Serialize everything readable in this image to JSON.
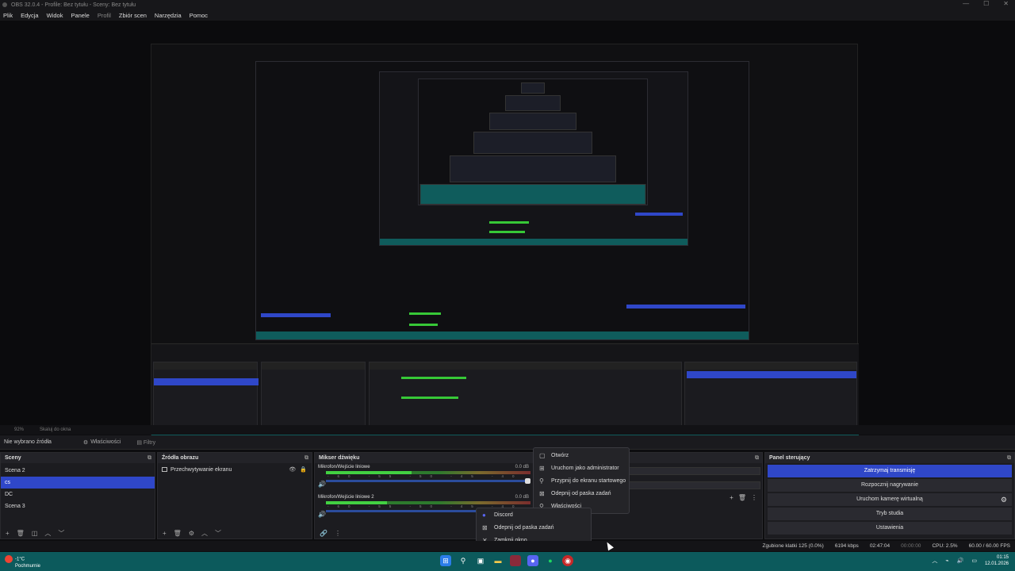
{
  "window": {
    "title": "OBS 32.0.4 - Profile: Bez tytułu - Sceny: Bez tytułu",
    "min": "—",
    "max": "☐",
    "close": "✕"
  },
  "menu": [
    "Plik",
    "Edycja",
    "Widok",
    "Panele",
    "Profil",
    "Zbiór scen",
    "Narzędzia",
    "Pomoc"
  ],
  "statusline": {
    "zoom": "92%",
    "mode": "Skaluj do okna"
  },
  "propbar": {
    "no_source": "Nie wybrano źródła",
    "properties": "Właściwości",
    "filters": "Filtry"
  },
  "scenes": {
    "title": "Sceny",
    "items": [
      "Scena 2",
      "cs",
      "DC",
      "Scena 3"
    ],
    "selected": 1
  },
  "sources": {
    "title": "Źródła obrazu",
    "items": [
      "Przechwytywanie ekranu"
    ]
  },
  "mixer": {
    "title": "Mikser dźwięku",
    "channels": [
      {
        "name": "Mikrofon/Wejście liniowe",
        "db": "0.0 dB",
        "level": 0.42
      },
      {
        "name": "Mikrofon/Wejście liniowe 2",
        "db": "0.0 dB",
        "level": 0.3
      }
    ],
    "ticks": "-60 -55 -50 -45 -40 -35 -30 -25 -20 -15 -10 -5 0"
  },
  "context_menu": {
    "items": [
      {
        "icon": "▢",
        "label": "Otwórz"
      },
      {
        "icon": "⊞",
        "label": "Uruchom jako administrator"
      },
      {
        "icon": "⚲",
        "label": "Przypnij do ekranu startowego"
      },
      {
        "icon": "⊠",
        "label": "Odepnij od paska zadań"
      },
      {
        "icon": "⚲",
        "label": "Właściwości"
      }
    ]
  },
  "jump_list": {
    "items": [
      {
        "icon": "●",
        "label": "Discord"
      },
      {
        "icon": "⊠",
        "label": "Odepnij od paska zadań"
      },
      {
        "icon": "✕",
        "label": "Zamknij okno"
      }
    ]
  },
  "controls": {
    "title": "Panel sterujący",
    "stop_stream": "Zatrzymaj transmisję",
    "start_record": "Rozpocznij nagrywanie",
    "virtual_cam": "Uruchom kamerę wirtualną",
    "studio_mode": "Tryb studia",
    "settings": "Ustawienia"
  },
  "status": {
    "dropped": "Zgubione klatki 125 (0.0%)",
    "kbps": "6194 kbps",
    "live_time": "02:47:04",
    "rec_time": "00:00:00",
    "cpu": "CPU: 2.5%",
    "fps": "60.00 / 60.00 FPS"
  },
  "taskbar": {
    "weather_temp": "-1°C",
    "weather_desc": "Pochmurnie",
    "time": "01:15",
    "date": "12.01.2026"
  },
  "colors": {
    "accent": "#2f47c8",
    "taskbar": "#0c5a5c",
    "meter_green": "#42d042"
  }
}
